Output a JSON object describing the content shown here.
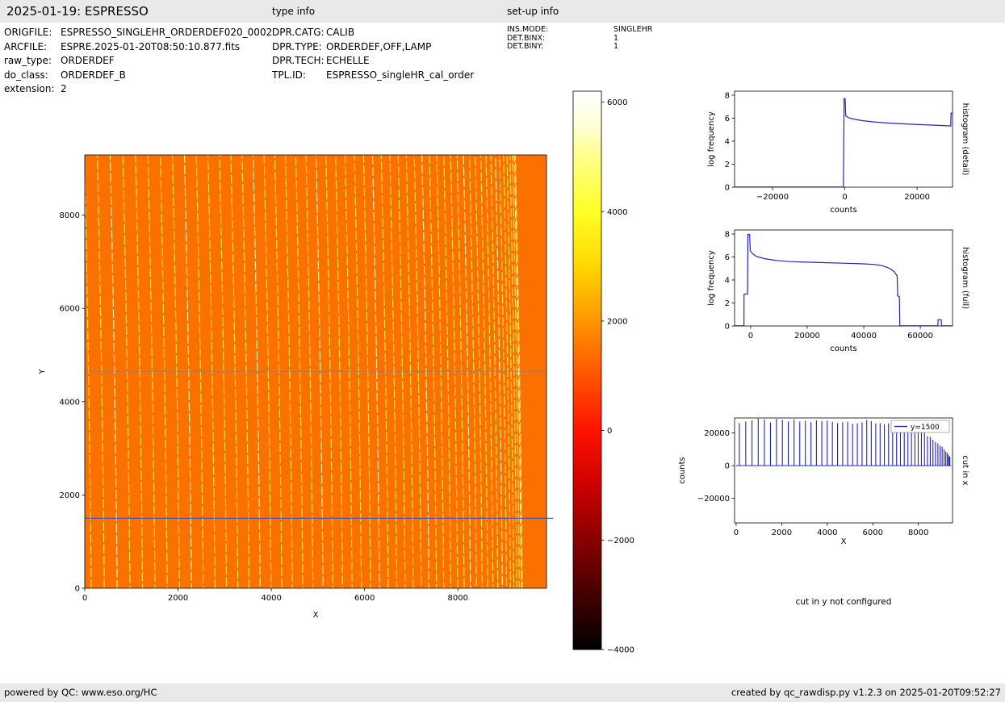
{
  "header": {
    "title": "2025-01-19: ESPRESSO",
    "type_info": "type info",
    "setup_info": "set-up info"
  },
  "meta": {
    "left": [
      {
        "label": "ORIGFILE:",
        "value": "ESPRESSO_SINGLEHR_ORDERDEF020_0002"
      },
      {
        "label": "ARCFILE:",
        "value": "ESPRE.2025-01-20T08:50:10.877.fits"
      },
      {
        "label": "raw_type:",
        "value": "ORDERDEF"
      },
      {
        "label": "do_class:",
        "value": "ORDERDEF_B"
      },
      {
        "label": "extension:",
        "value": "2"
      }
    ],
    "mid": [
      {
        "label": "DPR.CATG:",
        "value": "CALIB"
      },
      {
        "label": "DPR.TYPE:",
        "value": "ORDERDEF,OFF,LAMP"
      },
      {
        "label": "DPR.TECH:",
        "value": "ECHELLE"
      },
      {
        "label": "TPL.ID:",
        "value": "ESPRESSO_singleHR_cal_order"
      }
    ],
    "right": [
      {
        "label": "INS.MODE:",
        "value": "SINGLEHR"
      },
      {
        "label": "DET.BINX:",
        "value": "1"
      },
      {
        "label": "DET.BINY:",
        "value": "1"
      }
    ]
  },
  "notes": {
    "cut_in_y": "cut in y not configured"
  },
  "footer": {
    "left": "powered by QC: www.eso.org/HC",
    "right": "created by qc_rawdisp.py v1.2.3 on 2025-01-20T09:52:27"
  },
  "chart_data": [
    {
      "id": "raw_image",
      "type": "heatmap",
      "xlabel": "X",
      "ylabel": "Y",
      "xlim": [
        0,
        9900
      ],
      "ylim": [
        0,
        9290
      ],
      "xticks": [
        0,
        2000,
        4000,
        6000,
        8000
      ],
      "yticks": [
        0,
        2000,
        4000,
        6000,
        8000
      ],
      "colormap": "hot",
      "background_color": "#fb7100",
      "orders": {
        "n": 52,
        "x_start": 140,
        "x_end": 9380,
        "power": 1.55,
        "tilt_top": -150,
        "color": "#ffdf42",
        "bright_color": "#fff0a0"
      },
      "detector_gap_y": 4650,
      "cut_line": {
        "y": 1500,
        "color": "#3a55c8"
      }
    },
    {
      "id": "colorbar",
      "type": "colorbar",
      "vmin": -4000,
      "vmax": 6200,
      "ticks": [
        6000,
        4000,
        2000,
        0,
        -2000,
        -4000
      ],
      "stops": [
        [
          0.0,
          "#ffffff"
        ],
        [
          0.06,
          "#ffffd9"
        ],
        [
          0.118,
          "#ffff88"
        ],
        [
          0.216,
          "#ffff26"
        ],
        [
          0.314,
          "#ffd600"
        ],
        [
          0.412,
          "#ff9500"
        ],
        [
          0.51,
          "#ff5400"
        ],
        [
          0.608,
          "#ff1200"
        ],
        [
          0.706,
          "#cd0000"
        ],
        [
          0.804,
          "#890000"
        ],
        [
          0.902,
          "#440000"
        ],
        [
          1.0,
          "#000000"
        ]
      ]
    },
    {
      "id": "histogram_detail",
      "type": "line",
      "right_label": "histogram (detail)",
      "xlabel": "counts",
      "ylabel": "log frequency",
      "xlim": [
        -30500,
        29800
      ],
      "ylim": [
        0,
        8.35
      ],
      "xticks": [
        -20000,
        0,
        20000
      ],
      "yticks": [
        0,
        2,
        4,
        6,
        8
      ],
      "line_color": "#2222cc",
      "points": [
        [
          -30500,
          0.02
        ],
        [
          -400,
          0.02
        ],
        [
          -200,
          7.72
        ],
        [
          100,
          7.68
        ],
        [
          250,
          6.2
        ],
        [
          1200,
          6.02
        ],
        [
          2500,
          5.92
        ],
        [
          5000,
          5.78
        ],
        [
          8000,
          5.68
        ],
        [
          12000,
          5.58
        ],
        [
          18000,
          5.48
        ],
        [
          24000,
          5.4
        ],
        [
          28500,
          5.34
        ],
        [
          29300,
          5.32
        ],
        [
          29400,
          6.45
        ],
        [
          29800,
          6.42
        ]
      ]
    },
    {
      "id": "histogram_full",
      "type": "line",
      "right_label": "histogram (full)",
      "xlabel": "counts",
      "ylabel": "log frequency",
      "xlim": [
        -5700,
        71400
      ],
      "ylim": [
        0,
        8.35
      ],
      "xticks": [
        0,
        20000,
        40000,
        60000
      ],
      "yticks": [
        0,
        2,
        4,
        6,
        8
      ],
      "line_color": "#2222cc",
      "points": [
        [
          -5700,
          0.02
        ],
        [
          -2400,
          0.02
        ],
        [
          -2350,
          2.75
        ],
        [
          -1100,
          2.8
        ],
        [
          -1000,
          7.98
        ],
        [
          -350,
          7.95
        ],
        [
          -150,
          6.55
        ],
        [
          600,
          6.3
        ],
        [
          2000,
          6.05
        ],
        [
          5000,
          5.85
        ],
        [
          9000,
          5.7
        ],
        [
          14000,
          5.6
        ],
        [
          20000,
          5.55
        ],
        [
          27000,
          5.5
        ],
        [
          34000,
          5.45
        ],
        [
          40000,
          5.4
        ],
        [
          44000,
          5.35
        ],
        [
          46500,
          5.25
        ],
        [
          48200,
          5.1
        ],
        [
          49600,
          4.95
        ],
        [
          50800,
          4.7
        ],
        [
          51800,
          4.35
        ],
        [
          52000,
          2.62
        ],
        [
          52600,
          2.55
        ],
        [
          52750,
          0.02
        ],
        [
          66200,
          0.02
        ],
        [
          66300,
          0.55
        ],
        [
          67400,
          0.55
        ],
        [
          67500,
          0.02
        ],
        [
          71000,
          0.02
        ]
      ]
    },
    {
      "id": "cut_in_x",
      "type": "comb",
      "right_label": "cut in x",
      "xlabel": "X",
      "ylabel": "counts",
      "legend": "y=1500",
      "xlim": [
        -70,
        9500
      ],
      "ylim": [
        -35000,
        29100
      ],
      "xticks": [
        0,
        2000,
        4000,
        6000,
        8000
      ],
      "yticks": [
        -20000,
        0,
        20000
      ],
      "line_color": "#2222cc",
      "comb": {
        "n": 52,
        "x_start": 140,
        "x_end": 9380,
        "power": 1.55
      },
      "envelope": [
        [
          0,
          27000
        ],
        [
          500,
          27800
        ],
        [
          1500,
          27500
        ],
        [
          3000,
          27300
        ],
        [
          4500,
          27200
        ],
        [
          5500,
          27000
        ],
        [
          6000,
          26700
        ],
        [
          6500,
          26200
        ],
        [
          7000,
          25300
        ],
        [
          7400,
          24200
        ],
        [
          7800,
          22500
        ],
        [
          8200,
          20300
        ],
        [
          8600,
          17000
        ],
        [
          8900,
          13500
        ],
        [
          9100,
          10500
        ],
        [
          9250,
          8000
        ],
        [
          9380,
          5500
        ]
      ]
    }
  ]
}
